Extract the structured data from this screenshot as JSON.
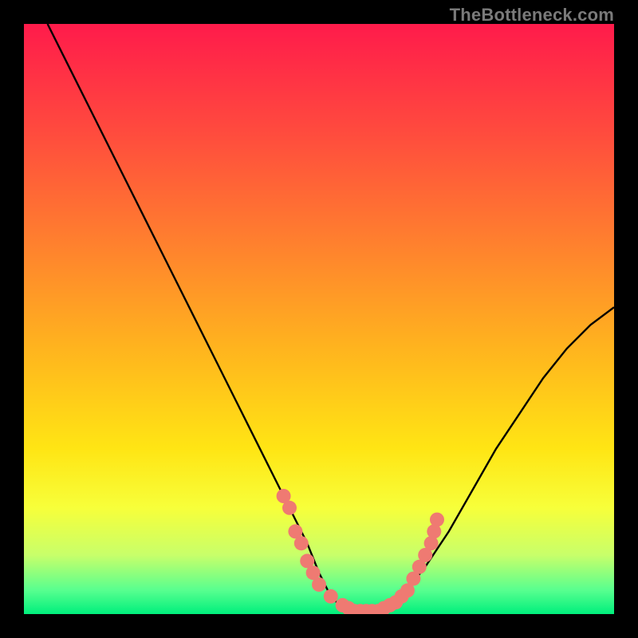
{
  "watermark": "TheBottleneck.com",
  "chart_data": {
    "type": "line",
    "title": "",
    "xlabel": "",
    "ylabel": "",
    "xlim": [
      0,
      100
    ],
    "ylim": [
      0,
      100
    ],
    "series": [
      {
        "name": "bottleneck-curve",
        "x": [
          4,
          8,
          12,
          16,
          20,
          24,
          28,
          32,
          36,
          40,
          44,
          48,
          50,
          52,
          54,
          56,
          58,
          60,
          62,
          64,
          68,
          72,
          76,
          80,
          84,
          88,
          92,
          96,
          100
        ],
        "y": [
          100,
          92,
          84,
          76,
          68,
          60,
          52,
          44,
          36,
          28,
          20,
          12,
          7,
          3,
          1,
          0,
          0,
          0,
          1,
          3,
          8,
          14,
          21,
          28,
          34,
          40,
          45,
          49,
          52
        ]
      }
    ],
    "markers": {
      "name": "highlighted-region",
      "points": [
        {
          "x": 44,
          "y": 20
        },
        {
          "x": 45,
          "y": 18
        },
        {
          "x": 46,
          "y": 14
        },
        {
          "x": 47,
          "y": 12
        },
        {
          "x": 48,
          "y": 9
        },
        {
          "x": 49,
          "y": 7
        },
        {
          "x": 50,
          "y": 5
        },
        {
          "x": 52,
          "y": 3
        },
        {
          "x": 54,
          "y": 1.5
        },
        {
          "x": 55,
          "y": 1
        },
        {
          "x": 56,
          "y": 0.5
        },
        {
          "x": 57,
          "y": 0.5
        },
        {
          "x": 58,
          "y": 0.5
        },
        {
          "x": 59,
          "y": 0.5
        },
        {
          "x": 60,
          "y": 0.5
        },
        {
          "x": 61,
          "y": 1
        },
        {
          "x": 62,
          "y": 1.5
        },
        {
          "x": 63,
          "y": 2
        },
        {
          "x": 64,
          "y": 3
        },
        {
          "x": 65,
          "y": 4
        },
        {
          "x": 66,
          "y": 6
        },
        {
          "x": 67,
          "y": 8
        },
        {
          "x": 68,
          "y": 10
        },
        {
          "x": 69,
          "y": 12
        },
        {
          "x": 69.5,
          "y": 14
        },
        {
          "x": 70,
          "y": 16
        }
      ]
    }
  }
}
